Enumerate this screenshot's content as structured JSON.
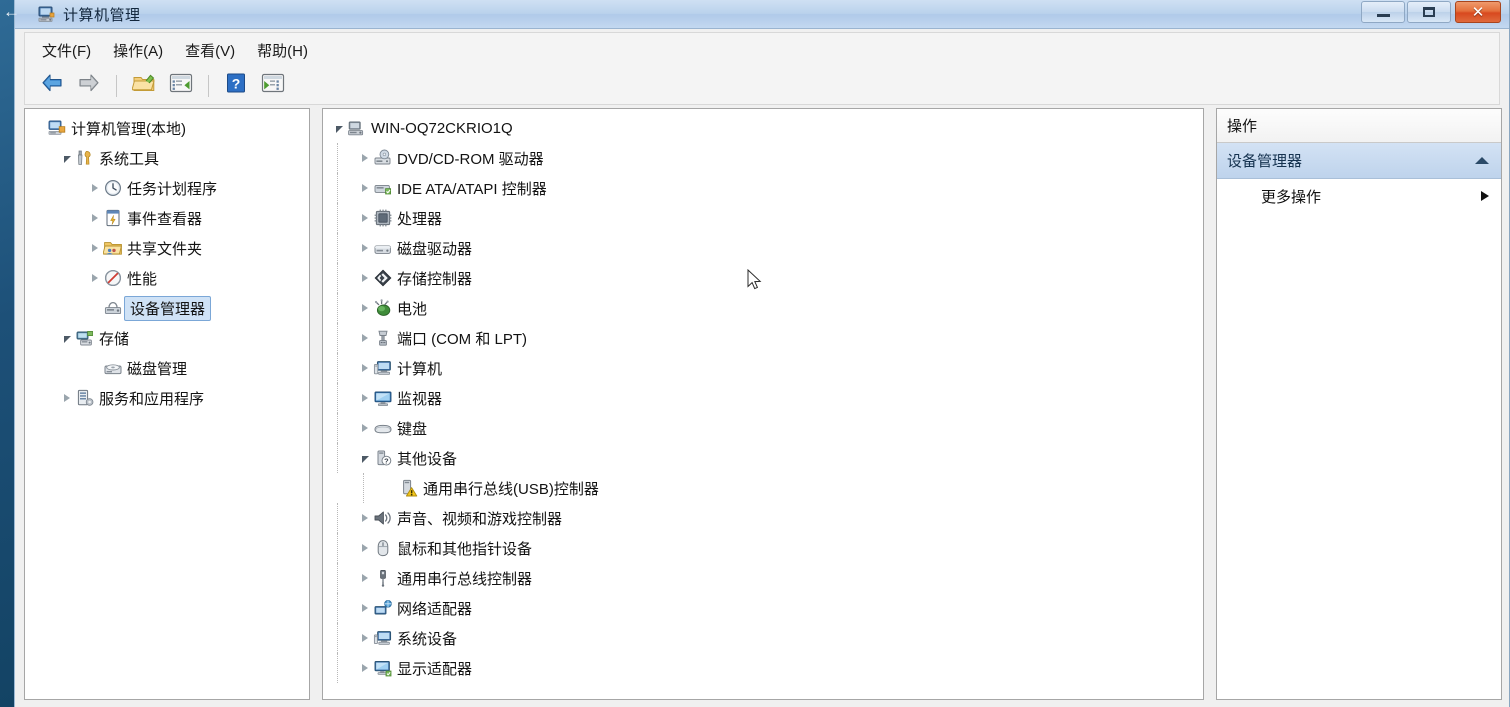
{
  "window": {
    "title": "计算机管理",
    "title_icon": "computer-management-icon",
    "controls": {
      "minimize": "最小化",
      "maximize": "最大化",
      "close": "关闭"
    },
    "colors": {
      "titlebar": "#bad2ec",
      "close_button": "#e4703c",
      "selection": "#cfe2f6",
      "actions_section": "#bed3ec",
      "desktop": "#1d5078"
    }
  },
  "menubar": {
    "items": [
      {
        "label": "文件(F)",
        "name": "menu-file"
      },
      {
        "label": "操作(A)",
        "name": "menu-action"
      },
      {
        "label": "查看(V)",
        "name": "menu-view"
      },
      {
        "label": "帮助(H)",
        "name": "menu-help"
      }
    ]
  },
  "toolbar": {
    "buttons": [
      {
        "icon": "back-arrow-icon",
        "label": "后退"
      },
      {
        "icon": "forward-arrow-icon",
        "label": "前进"
      },
      {
        "icon": "up-folder-icon",
        "label": "上一级"
      },
      {
        "icon": "show-hide-tree-icon",
        "label": "显示/隐藏控制台树"
      },
      {
        "icon": "help-icon",
        "label": "帮助"
      },
      {
        "icon": "show-hide-action-pane-icon",
        "label": "显示/隐藏操作窗格"
      }
    ]
  },
  "console_tree": {
    "items": [
      {
        "label": "计算机管理(本地)",
        "icon": "computer-management-icon",
        "indent": 0,
        "expander": "none",
        "selected": false
      },
      {
        "label": "系统工具",
        "icon": "system-tools-icon",
        "indent": 1,
        "expander": "open",
        "selected": false
      },
      {
        "label": "任务计划程序",
        "icon": "task-scheduler-icon",
        "indent": 2,
        "expander": "closed",
        "selected": false
      },
      {
        "label": "事件查看器",
        "icon": "event-viewer-icon",
        "indent": 2,
        "expander": "closed",
        "selected": false
      },
      {
        "label": "共享文件夹",
        "icon": "shared-folders-icon",
        "indent": 2,
        "expander": "closed",
        "selected": false
      },
      {
        "label": "性能",
        "icon": "performance-icon",
        "indent": 2,
        "expander": "closed",
        "selected": false
      },
      {
        "label": "设备管理器",
        "icon": "device-manager-icon",
        "indent": 2,
        "expander": "none",
        "selected": true
      },
      {
        "label": "存储",
        "icon": "storage-icon",
        "indent": 1,
        "expander": "open",
        "selected": false
      },
      {
        "label": "磁盘管理",
        "icon": "disk-management-icon",
        "indent": 2,
        "expander": "none",
        "selected": false
      },
      {
        "label": "服务和应用程序",
        "icon": "services-applications-icon",
        "indent": 1,
        "expander": "closed",
        "selected": false
      }
    ]
  },
  "device_tree": {
    "items": [
      {
        "label": "WIN-OQ72CKRIO1Q",
        "icon": "computer-root-icon",
        "indent": 0,
        "expander": "open",
        "warning": false
      },
      {
        "label": "DVD/CD-ROM 驱动器",
        "icon": "dvd-drive-icon",
        "indent": 1,
        "expander": "closed",
        "warning": false
      },
      {
        "label": "IDE ATA/ATAPI 控制器",
        "icon": "ide-controller-icon",
        "indent": 1,
        "expander": "closed",
        "warning": false
      },
      {
        "label": "处理器",
        "icon": "processor-icon",
        "indent": 1,
        "expander": "closed",
        "warning": false
      },
      {
        "label": "磁盘驱动器",
        "icon": "disk-drive-icon",
        "indent": 1,
        "expander": "closed",
        "warning": false
      },
      {
        "label": "存储控制器",
        "icon": "storage-controller-icon",
        "indent": 1,
        "expander": "closed",
        "warning": false
      },
      {
        "label": "电池",
        "icon": "battery-icon",
        "indent": 1,
        "expander": "closed",
        "warning": false
      },
      {
        "label": "端口 (COM 和 LPT)",
        "icon": "ports-icon",
        "indent": 1,
        "expander": "closed",
        "warning": false
      },
      {
        "label": "计算机",
        "icon": "computer-icon",
        "indent": 1,
        "expander": "closed",
        "warning": false
      },
      {
        "label": "监视器",
        "icon": "monitor-icon",
        "indent": 1,
        "expander": "closed",
        "warning": false
      },
      {
        "label": "键盘",
        "icon": "keyboard-icon",
        "indent": 1,
        "expander": "closed",
        "warning": false
      },
      {
        "label": "其他设备",
        "icon": "other-devices-icon",
        "indent": 1,
        "expander": "open",
        "warning": false
      },
      {
        "label": "通用串行总线(USB)控制器",
        "icon": "unknown-device-icon",
        "indent": 2,
        "expander": "none",
        "warning": true
      },
      {
        "label": "声音、视频和游戏控制器",
        "icon": "sound-video-game-icon",
        "indent": 1,
        "expander": "closed",
        "warning": false
      },
      {
        "label": "鼠标和其他指针设备",
        "icon": "mouse-icon",
        "indent": 1,
        "expander": "closed",
        "warning": false
      },
      {
        "label": "通用串行总线控制器",
        "icon": "usb-controller-icon",
        "indent": 1,
        "expander": "closed",
        "warning": false
      },
      {
        "label": "网络适配器",
        "icon": "network-adapter-icon",
        "indent": 1,
        "expander": "closed",
        "warning": false
      },
      {
        "label": "系统设备",
        "icon": "system-device-icon",
        "indent": 1,
        "expander": "closed",
        "warning": false
      },
      {
        "label": "显示适配器",
        "icon": "display-adapter-icon",
        "indent": 1,
        "expander": "closed",
        "warning": false
      }
    ]
  },
  "actions_pane": {
    "header": "操作",
    "section_title": "设备管理器",
    "more_actions": "更多操作"
  }
}
